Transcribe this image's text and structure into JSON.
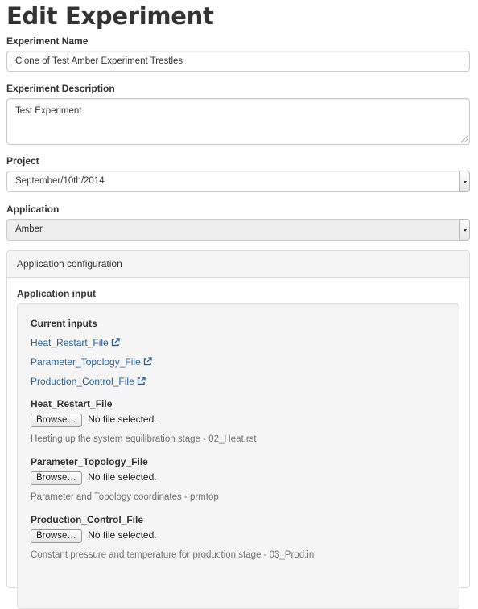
{
  "page": {
    "title": "Edit Experiment"
  },
  "form": {
    "name_label": "Experiment Name",
    "name_value": "Clone of Test Amber Experiment Trestles",
    "description_label": "Experiment Description",
    "description_value": "Test Experiment",
    "project_label": "Project",
    "project_value": "September/10th/2014",
    "application_label": "Application",
    "application_value": "Amber"
  },
  "config": {
    "heading": "Application configuration",
    "input_title": "Application input",
    "current_inputs_title": "Current inputs",
    "current_inputs": [
      {
        "label": "Heat_Restart_File",
        "icon": "external-link-icon"
      },
      {
        "label": "Parameter_Topology_File",
        "icon": "external-link-icon"
      },
      {
        "label": "Production_Control_File",
        "icon": "external-link-icon"
      }
    ],
    "file_inputs": [
      {
        "label": "Heat_Restart_File",
        "button": "Browse…",
        "status": "No file selected.",
        "help": "Heating up the system equilibration stage - 02_Heat.rst"
      },
      {
        "label": "Parameter_Topology_File",
        "button": "Browse…",
        "status": "No file selected.",
        "help": "Parameter and Topology coordinates - prmtop"
      },
      {
        "label": "Production_Control_File",
        "button": "Browse…",
        "status": "No file selected.",
        "help": "Constant pressure and temperature for production stage - 03_Prod.in"
      }
    ]
  },
  "colors": {
    "link": "#2a6496",
    "help_text": "#737373",
    "panel_bg": "#f5f5f5"
  }
}
